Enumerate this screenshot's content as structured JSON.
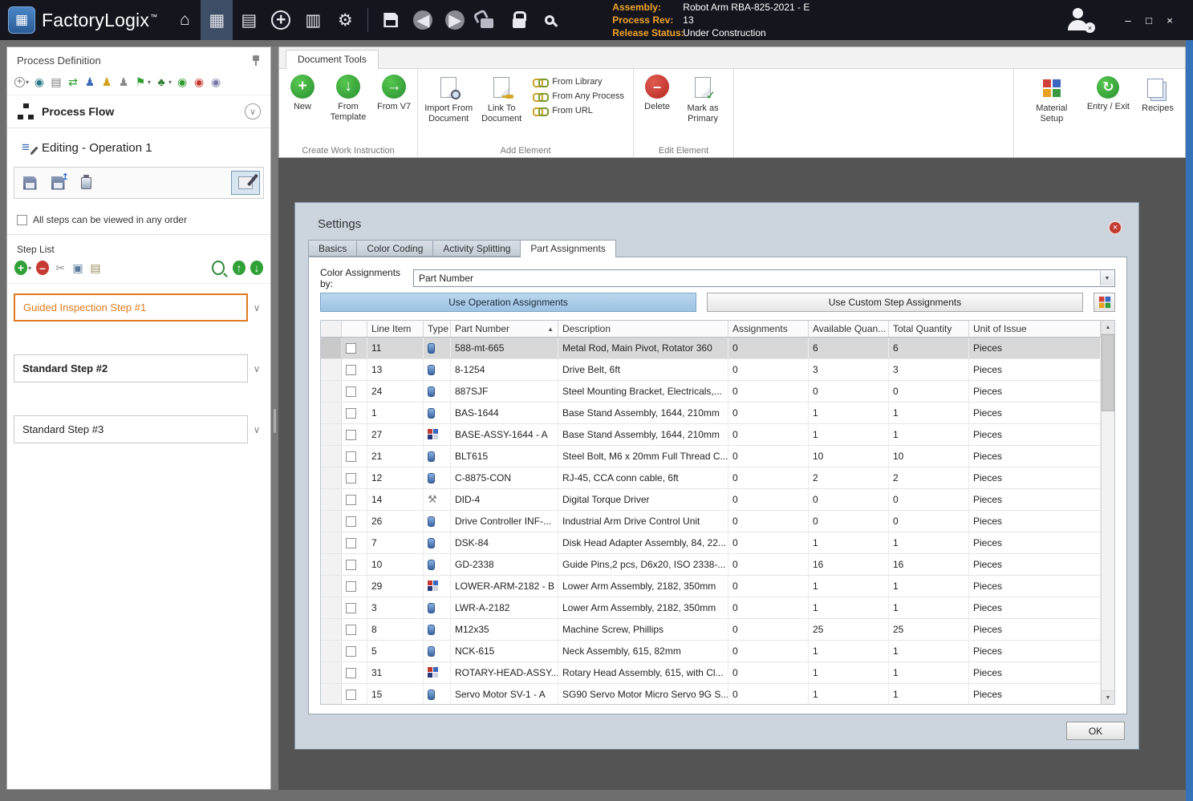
{
  "glyphs": {
    "caret": "▾",
    "chevron_down": "∨",
    "close": "×",
    "sort_asc": "▲",
    "scroll_up": "▲",
    "scroll_down": "▼",
    "dd_caret": "▼",
    "user_x": "×"
  },
  "titlebar": {
    "app_name": "FactoryLogix",
    "trademark": "™",
    "icons": [
      {
        "name": "home-icon",
        "g": "⌂"
      },
      {
        "name": "process-definition-icon",
        "g": "▦",
        "sel": true
      },
      {
        "name": "production-docs-icon",
        "g": "▤"
      },
      {
        "name": "navigator-icon",
        "g": "+",
        "kind": "navcirc"
      },
      {
        "name": "news-icon",
        "g": "▥"
      },
      {
        "name": "settings-gear-icon",
        "g": "⚙"
      },
      {
        "name": "toolbar-divider",
        "kind": "divider"
      },
      {
        "name": "save-icon",
        "kind": "floppy-w"
      },
      {
        "name": "back-icon",
        "g": "◀",
        "kind": "circgray"
      },
      {
        "name": "forward-icon",
        "g": "▶",
        "kind": "circgray"
      },
      {
        "name": "unlock-icon",
        "kind": "lock-open"
      },
      {
        "name": "lock-icon",
        "kind": "lock-closed"
      },
      {
        "name": "inspect-icon",
        "kind": "mag-w"
      }
    ],
    "info": {
      "assembly_label": "Assembly:",
      "assembly_value": "Robot Arm RBA-825-2021 - E",
      "process_rev_label": "Process Rev:",
      "process_rev_value": "13",
      "release_status_label": "Release Status:",
      "release_status_value": "Under Construction"
    },
    "window_controls": [
      {
        "name": "minimize-button",
        "g": "–"
      },
      {
        "name": "maximize-button",
        "g": "□"
      },
      {
        "name": "close-button",
        "g": "×"
      }
    ]
  },
  "sidebar": {
    "title": "Process Definition",
    "toolbar_icons": [
      {
        "name": "add-icon",
        "g": "+",
        "kind": "si-circ",
        "c": "#8a8a8a",
        "caret": true
      },
      {
        "name": "web-icon",
        "g": "◉",
        "c": "#2b7a8a"
      },
      {
        "name": "print-icon",
        "g": "▤",
        "c": "#777777"
      },
      {
        "name": "exchange-icon",
        "g": "⇄",
        "c": "#2e9e2e"
      },
      {
        "name": "user-blue-icon",
        "g": "♟",
        "c": "#3a6ab8"
      },
      {
        "name": "user-gold-icon",
        "g": "♟",
        "c": "#d4a017"
      },
      {
        "name": "user-shield-icon",
        "g": "♟",
        "c": "#8a8a8a"
      },
      {
        "name": "publish-icon",
        "g": "⚑",
        "c": "#2e9e2e",
        "caret": true
      },
      {
        "name": "tree-icon",
        "g": "♣",
        "c": "#2e7d32",
        "caret": true
      },
      {
        "name": "start-icon",
        "g": "◉",
        "c": "#2e9e2e"
      },
      {
        "name": "stop-icon",
        "g": "◉",
        "c": "#c63a32"
      },
      {
        "name": "status-icon",
        "g": "◉",
        "c": "#7a7aa8"
      }
    ],
    "process_flow_label": "Process Flow",
    "editing_label": "Editing - Operation 1",
    "view_order_label": "All steps can be viewed in any order",
    "step_list_label": "Step List",
    "step_toolbar_icons": [
      {
        "name": "add-step-icon",
        "g": "+",
        "kind": "circ-green-s",
        "caret": true
      },
      {
        "name": "remove-step-icon",
        "g": "–",
        "kind": "circ-red-s"
      },
      {
        "name": "cut-step-icon",
        "g": "✂",
        "c": "#8a8a8a"
      },
      {
        "name": "copy-step-icon",
        "g": "▣",
        "c": "#5a7a9a"
      },
      {
        "name": "paste-step-icon",
        "g": "▤",
        "c": "#9a8a5a"
      },
      {
        "name": "spacer",
        "kind": "spacer"
      },
      {
        "name": "zoom-step-icon",
        "kind": "mag-g"
      },
      {
        "name": "move-up-icon",
        "g": "↑",
        "kind": "circ-green-s"
      },
      {
        "name": "move-down-icon",
        "g": "↓",
        "kind": "circ-green-s"
      }
    ],
    "edit_buttons": [
      {
        "name": "save-step-icon",
        "kind": "floppy-d"
      },
      {
        "name": "import-step-icon",
        "kind": "floppy-d",
        "overlay": "↥"
      },
      {
        "name": "clear-step-icon",
        "kind": "jar"
      }
    ],
    "steps": [
      {
        "label": "Guided Inspection Step #1",
        "style": "selected"
      },
      {
        "label": "Standard Step #2",
        "style": "bold"
      },
      {
        "label": "Standard Step #3",
        "style": "normal"
      }
    ]
  },
  "ribbon": {
    "tab_label": "Document Tools",
    "groups": [
      {
        "label": "Create Work Instruction",
        "name": "create-work-instruction-group",
        "buttons": [
          {
            "name": "new-button",
            "label": "New",
            "icon": "big-green",
            "g": "+"
          },
          {
            "name": "from-template-button",
            "label": "From Template",
            "icon": "big-green",
            "g": "↓"
          },
          {
            "name": "from-v7-button",
            "label": "From V7",
            "icon": "big-green",
            "g": "→"
          }
        ]
      },
      {
        "label": "Add Element",
        "name": "add-element-group",
        "buttons": [
          {
            "name": "import-from-document-button",
            "label": "Import From Document",
            "icon": "doc-search"
          },
          {
            "name": "link-to-document-button",
            "label": "Link To Document",
            "icon": "doc-key"
          }
        ],
        "small": [
          {
            "name": "from-library-button",
            "label": "From Library",
            "icon": "chain"
          },
          {
            "name": "from-any-process-button",
            "label": "From Any Process",
            "icon": "chain"
          },
          {
            "name": "from-url-button",
            "label": "From URL",
            "icon": "chain"
          }
        ]
      },
      {
        "label": "Edit Element",
        "name": "edit-element-group",
        "buttons": [
          {
            "name": "delete-button",
            "label": "Delete",
            "icon": "big-red",
            "g": "–"
          },
          {
            "name": "mark-as-primary-button",
            "label": "Mark as Primary",
            "icon": "doc-check"
          }
        ]
      }
    ],
    "right_buttons": [
      {
        "name": "material-setup-button",
        "label": "Material Setup",
        "icon": "material"
      },
      {
        "name": "entry-exit-button",
        "label": "Entry / Exit",
        "icon": "loop-green",
        "g": "↻"
      },
      {
        "name": "recipes-button",
        "label": "Recipes",
        "icon": "doc-stack"
      }
    ]
  },
  "settings": {
    "title": "Settings",
    "tabs": [
      {
        "label": "Basics"
      },
      {
        "label": "Color Coding"
      },
      {
        "label": "Activity Splitting"
      },
      {
        "label": "Part Assignments",
        "active": true
      }
    ],
    "color_by_label": "Color Assignments by:",
    "color_by_value": "Part Number",
    "operation_assignments_label": "Use Operation Assignments",
    "custom_assignments_label": "Use Custom Step Assignments",
    "ok_label": "OK",
    "table": {
      "columns": [
        "Line Item",
        "Type",
        "Part Number",
        "Description",
        "Assignments",
        "Available Quan...",
        "Total Quantity",
        "Unit of Issue"
      ],
      "sorted_column": "Part Number",
      "rows": [
        {
          "line": "11",
          "type": "part",
          "part": "588-mt-665",
          "desc": "Metal Rod, Main Pivot, Rotator 360",
          "assign": "0",
          "avail": "6",
          "total": "6",
          "unit": "Pieces",
          "selected": true
        },
        {
          "line": "13",
          "type": "part",
          "part": "8-1254",
          "desc": "Drive Belt, 6ft",
          "assign": "0",
          "avail": "3",
          "total": "3",
          "unit": "Pieces"
        },
        {
          "line": "24",
          "type": "part",
          "part": "887SJF",
          "desc": "Steel Mounting Bracket, Electricals,...",
          "assign": "0",
          "avail": "0",
          "total": "0",
          "unit": "Pieces"
        },
        {
          "line": "1",
          "type": "part",
          "part": "BAS-1644",
          "desc": "Base Stand Assembly, 1644, 210mm",
          "assign": "0",
          "avail": "1",
          "total": "1",
          "unit": "Pieces"
        },
        {
          "line": "27",
          "type": "assembly",
          "part": "BASE-ASSY-1644 - A",
          "desc": "Base Stand Assembly, 1644, 210mm",
          "assign": "0",
          "avail": "1",
          "total": "1",
          "unit": "Pieces"
        },
        {
          "line": "21",
          "type": "part",
          "part": "BLT615",
          "desc": "Steel Bolt, M6 x 20mm Full Thread C...",
          "assign": "0",
          "avail": "10",
          "total": "10",
          "unit": "Pieces"
        },
        {
          "line": "12",
          "type": "part",
          "part": "C-8875-CON",
          "desc": "RJ-45, CCA conn cable, 6ft",
          "assign": "0",
          "avail": "2",
          "total": "2",
          "unit": "Pieces"
        },
        {
          "line": "14",
          "type": "tool",
          "part": "DID-4",
          "desc": "Digital Torque Driver",
          "assign": "0",
          "avail": "0",
          "total": "0",
          "unit": "Pieces"
        },
        {
          "line": "26",
          "type": "part",
          "part": "Drive Controller INF-...",
          "desc": "Industrial Arm Drive Control Unit",
          "assign": "0",
          "avail": "0",
          "total": "0",
          "unit": "Pieces"
        },
        {
          "line": "7",
          "type": "part",
          "part": "DSK-84",
          "desc": "Disk Head Adapter Assembly, 84, 22...",
          "assign": "0",
          "avail": "1",
          "total": "1",
          "unit": "Pieces"
        },
        {
          "line": "10",
          "type": "part",
          "part": "GD-2338",
          "desc": "Guide Pins,2 pcs, D6x20, ISO 2338-...",
          "assign": "0",
          "avail": "16",
          "total": "16",
          "unit": "Pieces"
        },
        {
          "line": "29",
          "type": "assembly",
          "part": "LOWER-ARM-2182 - B",
          "desc": "Lower Arm Assembly, 2182, 350mm",
          "assign": "0",
          "avail": "1",
          "total": "1",
          "unit": "Pieces"
        },
        {
          "line": "3",
          "type": "part",
          "part": "LWR-A-2182",
          "desc": "Lower Arm Assembly, 2182, 350mm",
          "assign": "0",
          "avail": "1",
          "total": "1",
          "unit": "Pieces"
        },
        {
          "line": "8",
          "type": "part",
          "part": "M12x35",
          "desc": "Machine Screw, Phillips",
          "assign": "0",
          "avail": "25",
          "total": "25",
          "unit": "Pieces"
        },
        {
          "line": "5",
          "type": "part",
          "part": "NCK-615",
          "desc": "Neck Assembly, 615, 82mm",
          "assign": "0",
          "avail": "1",
          "total": "1",
          "unit": "Pieces"
        },
        {
          "line": "31",
          "type": "assembly",
          "part": "ROTARY-HEAD-ASSY...",
          "desc": "Rotary Head Assembly, 615, with Cl...",
          "assign": "0",
          "avail": "1",
          "total": "1",
          "unit": "Pieces"
        },
        {
          "line": "15",
          "type": "part",
          "part": "Servo Motor SV-1 - A",
          "desc": "SG90 Servo Motor Micro Servo 9G S...",
          "assign": "0",
          "avail": "1",
          "total": "1",
          "unit": "Pieces"
        }
      ]
    }
  }
}
